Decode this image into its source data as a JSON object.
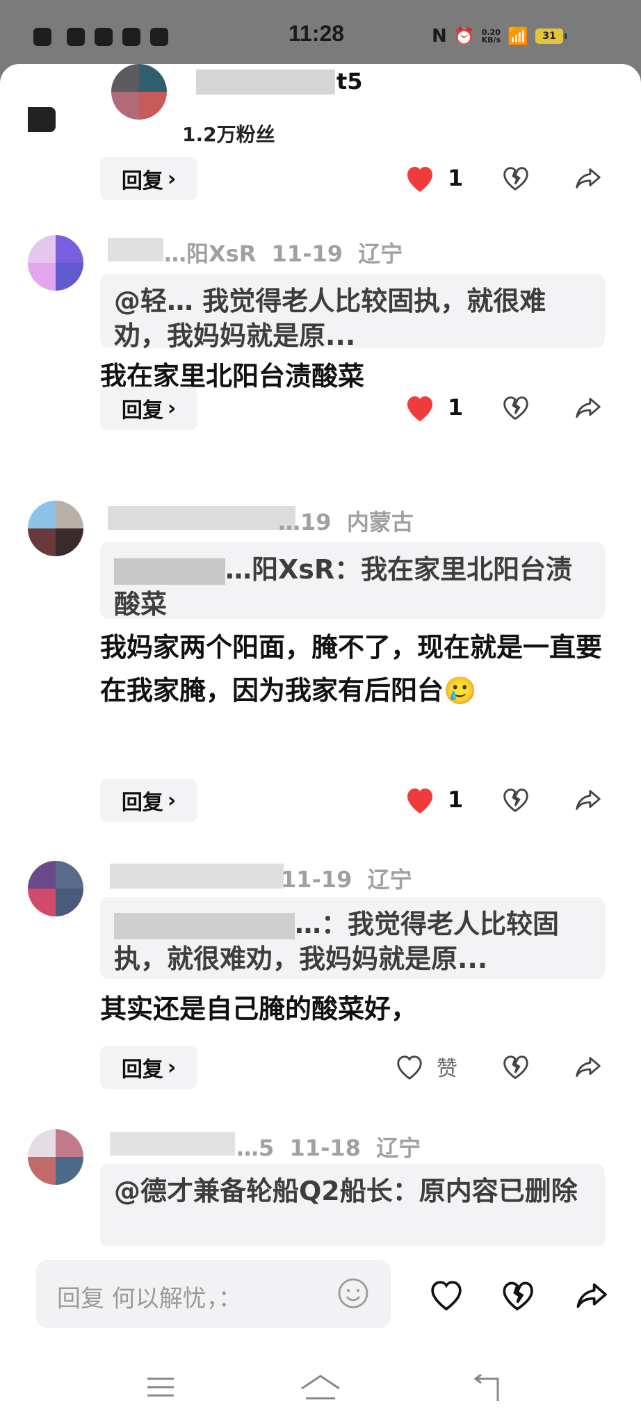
{
  "status_bar": {
    "time": "11:28",
    "net_speed_top": "0.20",
    "net_speed_bottom": "KB/s",
    "battery": "31"
  },
  "first_comment": {
    "name_visible": "t5",
    "fans": "1.2万粉丝",
    "reply_label": "回复",
    "like_count": "1"
  },
  "comments": [
    {
      "meta_name": "…阳XsR",
      "date": "11-19",
      "region": "辽宁",
      "quote": "@轻… 我觉得老人比较固执，就很难劝，我妈妈就是原...",
      "text": "我在家里北阳台渍酸菜",
      "reply_label": "回复",
      "like_count": "1"
    },
    {
      "meta_name": "",
      "date": "…19",
      "region": "内蒙古",
      "quote": "…阳XsR：我在家里北阳台渍酸菜",
      "text": "我妈家两个阳面，腌不了，现在就是一直要在我家腌，因为我家有后阳台",
      "emoji": "🥲",
      "reply_label": "回复",
      "like_count": "1"
    },
    {
      "meta_name": "",
      "date": "11-19",
      "region": "辽宁",
      "quote": "…：我觉得老人比较固执，就很难劝，我妈妈就是原...",
      "text": "其实还是自己腌的酸菜好，",
      "reply_label": "回复",
      "like_label": "赞"
    },
    {
      "meta_name": "…5",
      "date": "11-18",
      "region": "辽宁",
      "quote": "@德才兼备轮船Q2船长：原内容已删除"
    }
  ],
  "input_bar": {
    "placeholder": "回复 何以解忧，："
  },
  "icons": {
    "like_filled": "heart-filled-icon",
    "like_outline": "heart-outline-icon",
    "dislike": "broken-heart-icon",
    "share": "share-icon",
    "emoji": "smiley-icon",
    "nav_menu": "menu-icon",
    "nav_home": "home-icon",
    "nav_back": "back-icon"
  },
  "colors": {
    "like_red": "#ef3b3b",
    "quote_bg": "#f3f3f5",
    "meta_gray": "#a0a0a0"
  }
}
